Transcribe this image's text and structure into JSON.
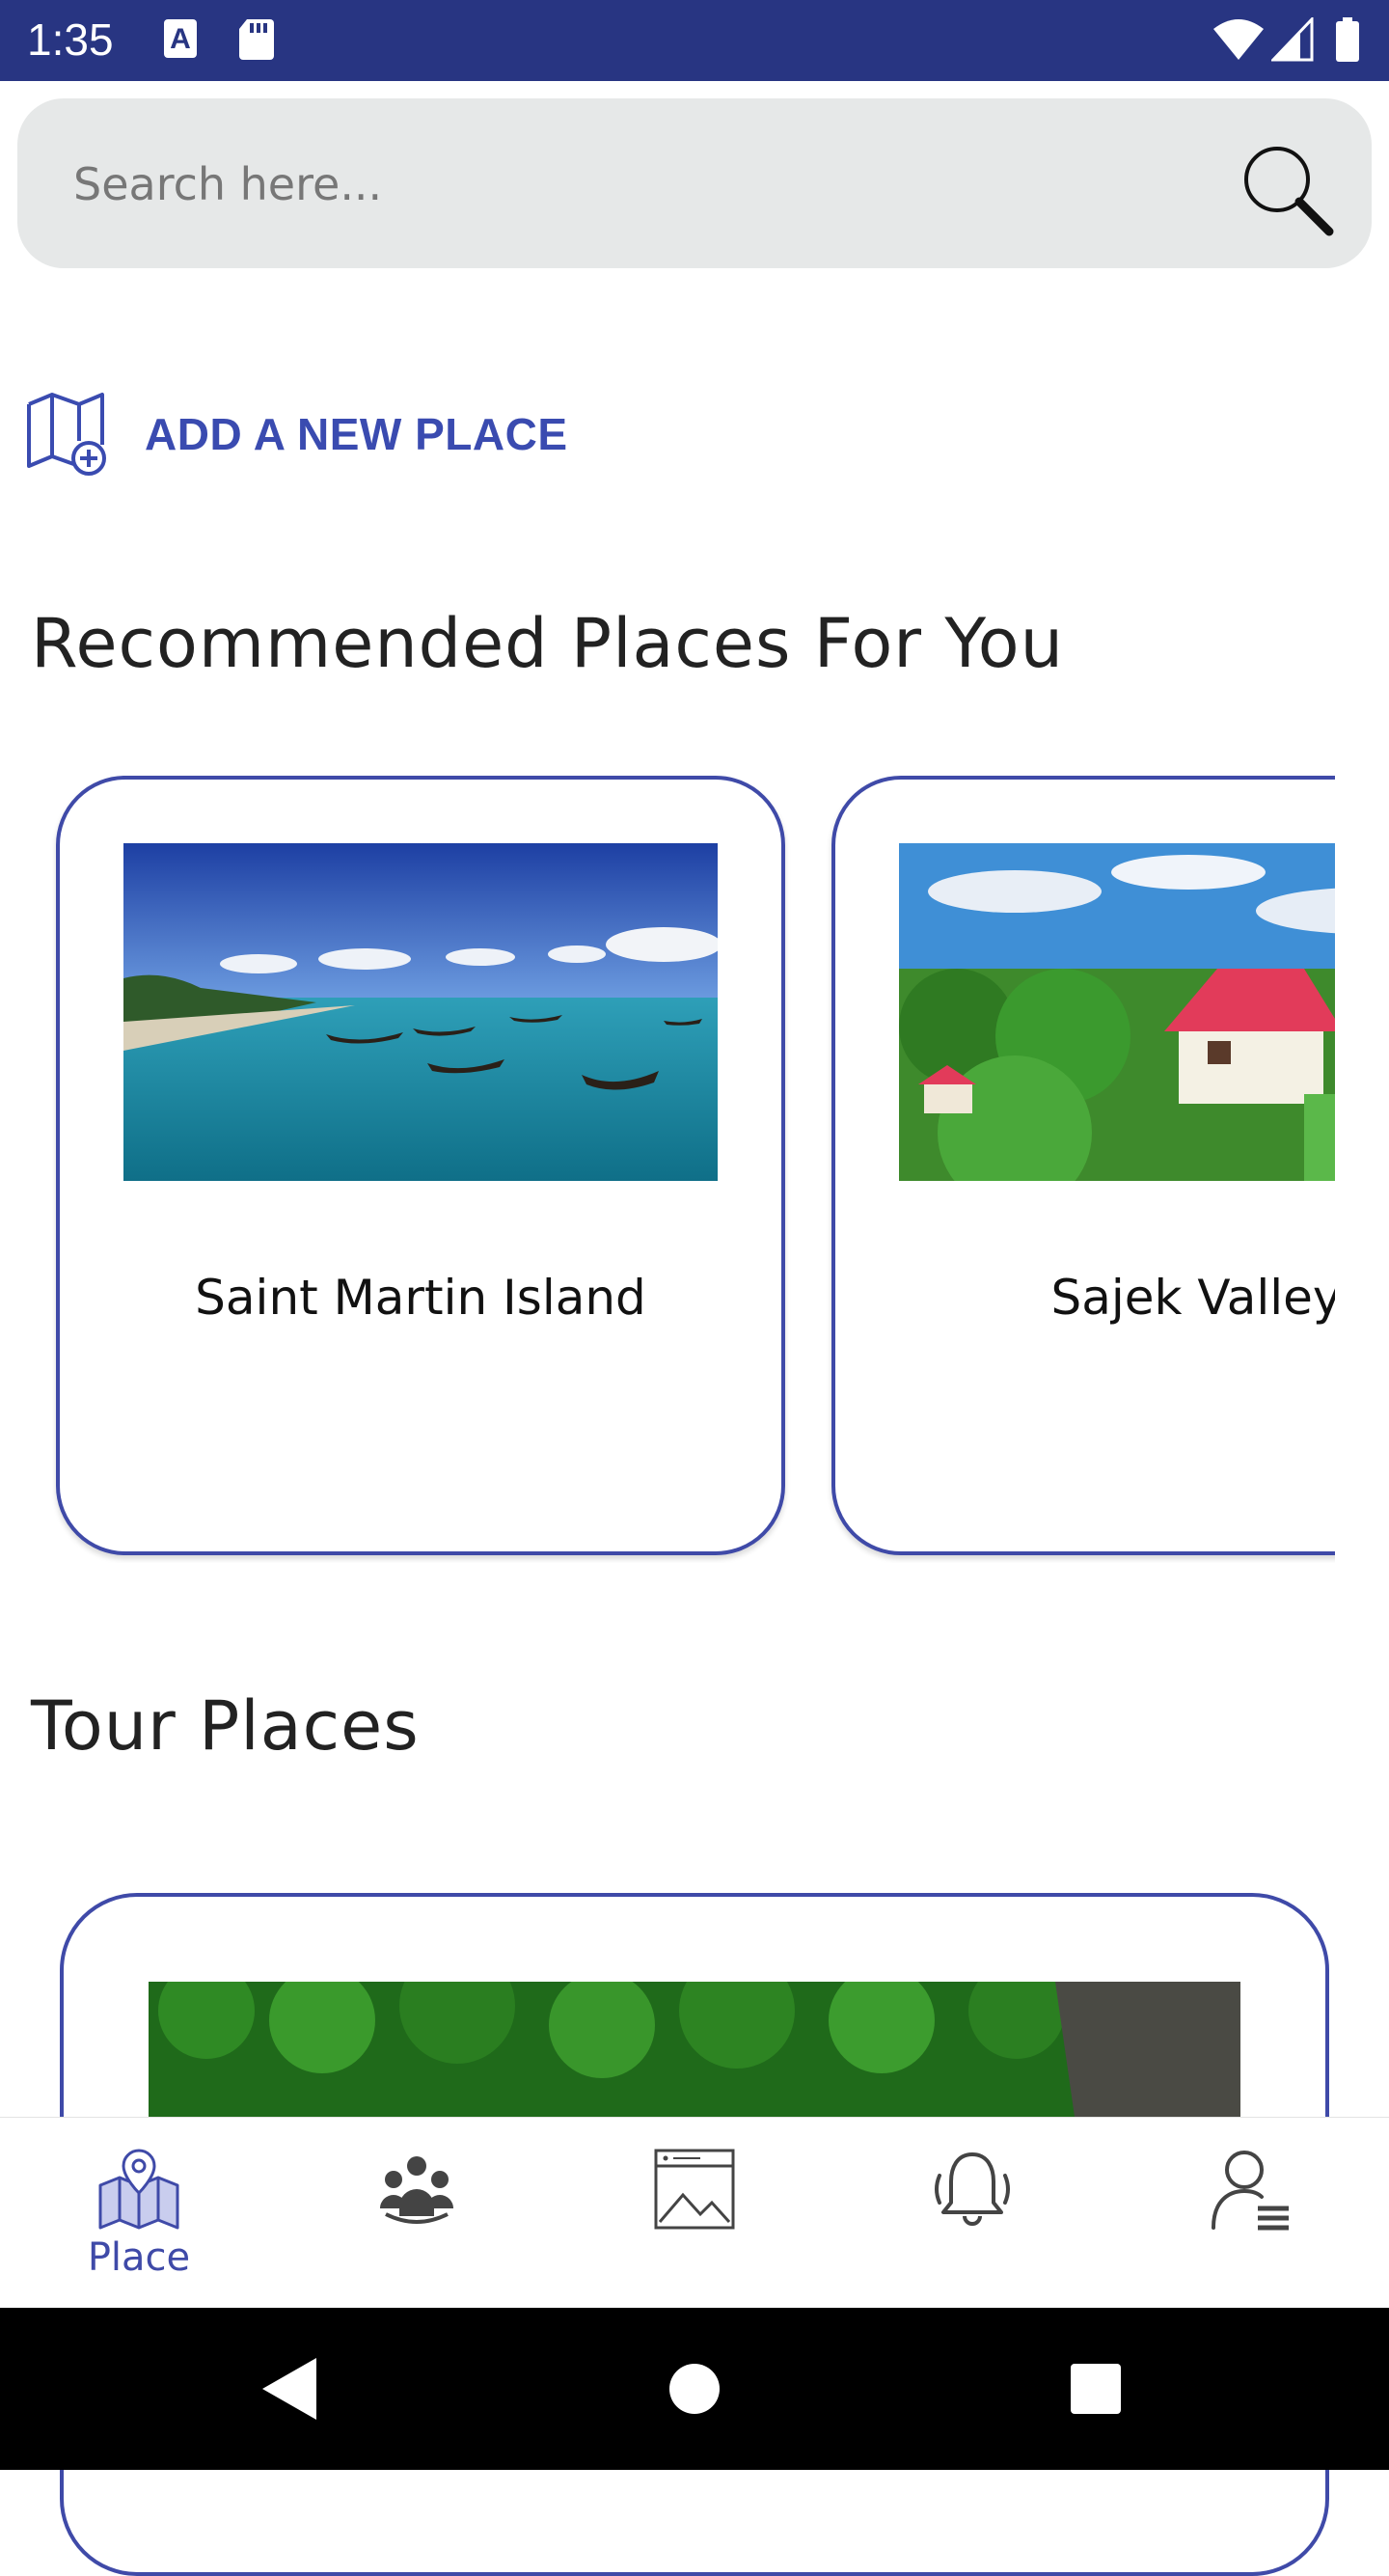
{
  "status_bar": {
    "time": "1:35",
    "icons": [
      "font-a-icon",
      "sd-card-icon",
      "wifi-icon",
      "signal-icon",
      "battery-icon"
    ]
  },
  "search": {
    "placeholder": "Search here...",
    "value": ""
  },
  "add_place": {
    "label": "ADD A NEW PLACE",
    "icon": "map-plus-icon"
  },
  "recommended": {
    "title": "Recommended Places For You",
    "cards": [
      {
        "title": "Saint Martin Island",
        "image": "beach-boats-photo"
      },
      {
        "title": "Sajek Valley",
        "image": "hill-cottage-photo"
      }
    ]
  },
  "tour": {
    "title": "Tour Places",
    "cards": [
      {
        "image": "green-forest-photo"
      }
    ]
  },
  "bottom_nav": {
    "items": [
      {
        "label": "Place",
        "icon": "map-pin-icon",
        "active": true
      },
      {
        "label": "",
        "icon": "group-icon",
        "active": false
      },
      {
        "label": "",
        "icon": "gallery-icon",
        "active": false
      },
      {
        "label": "",
        "icon": "bell-icon",
        "active": false
      },
      {
        "label": "",
        "icon": "profile-list-icon",
        "active": false
      }
    ]
  },
  "colors": {
    "status_bar": "#283582",
    "accent": "#3f4aa8",
    "search_bg": "#e6e8e8"
  }
}
